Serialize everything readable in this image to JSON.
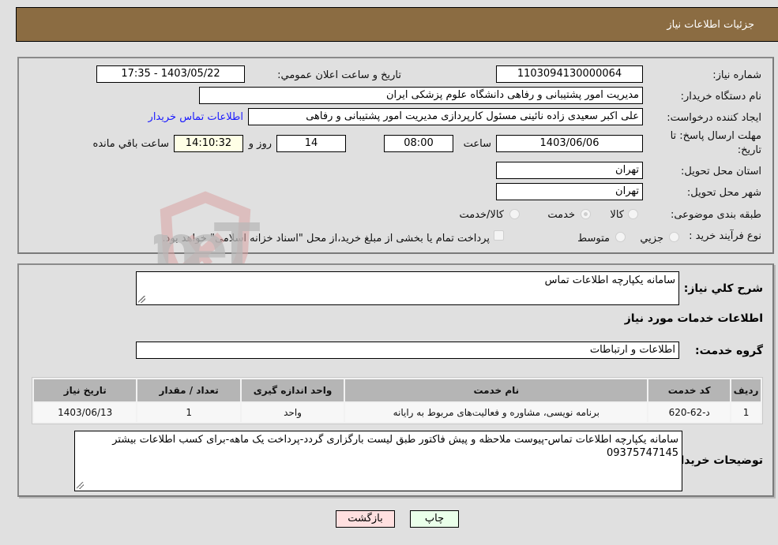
{
  "header": {
    "title": "جزئیات اطلاعات نیاز"
  },
  "fields": {
    "need_number_label": "شماره نیاز:",
    "need_number": "1103094130000064",
    "announce_label": "تاریخ و ساعت اعلان عمومي:",
    "announce_value": "1403/05/22 - 17:35",
    "buyer_org_label": "نام دستگاه خریدار:",
    "buyer_org": "مدیریت امور پشتیبانی و رفاهی دانشگاه علوم پزشکی ایران",
    "creator_label": "ایجاد کننده درخواست:",
    "creator": "علی اکبر سعیدی زاده نائینی مسئول کارپردازی مدیریت امور پشتیبانی و رفاهی",
    "buyer_contact_link": "اطلاعات تماس خریدار",
    "deadline_label_1": "مهلت ارسال پاسخ: تا",
    "deadline_label_2": "تاریخ:",
    "deadline_date": "1403/06/06",
    "time_label": "ساعت",
    "deadline_time": "08:00",
    "days_value": "14",
    "days_label": "روز و",
    "remaining_time": "14:10:32",
    "remaining_label": "ساعت باقي مانده",
    "province_label": "استان محل تحویل:",
    "province": "تهران",
    "city_label": "شهر محل تحویل:",
    "city": "تهران",
    "category_label": "طبقه بندی موضوعی:",
    "category_options": [
      "کالا",
      "خدمت",
      "کالا/خدمت"
    ],
    "category_selected": "خدمت",
    "process_label": "نوع فرآیند خرید :",
    "process_options": [
      "جزیي",
      "متوسط"
    ],
    "treasury_note": "پرداخت تمام یا بخشی از مبلغ خرید،از محل \"اسناد خزانه اسلامی\" خواهد بود."
  },
  "details": {
    "summary_label": "شرح کلي نیاز:",
    "summary": "سامانه یکپارچه اطلاعات تماس",
    "services_heading": "اطلاعات خدمات مورد نیاز",
    "service_group_label": "گروه خدمت:",
    "service_group": "اطلاعات و ارتباطات",
    "table": {
      "headers": [
        "ردیف",
        "کد خدمت",
        "نام خدمت",
        "واحد اندازه گیری",
        "تعداد / مقدار",
        "تاریخ نیاز"
      ],
      "rows": [
        [
          "1",
          "د-62-620",
          "برنامه نویسی، مشاوره و فعالیت‌های مربوط به رایانه",
          "واحد",
          "1",
          "1403/06/13"
        ]
      ]
    },
    "buyer_notes_label": "توضیحات خریدار:",
    "buyer_notes": "سامانه یکپارچه اطلاعات تماس-پیوست ملاحظه و پیش فاکتور طبق لیست بارگزاری گردد-پرداخت یک ماهه-برای کسب اطلاعات بیشتر 09375747145"
  },
  "buttons": {
    "print": "چاپ",
    "back": "بازگشت"
  },
  "watermark": {
    "text": "AriaTender.neT"
  }
}
